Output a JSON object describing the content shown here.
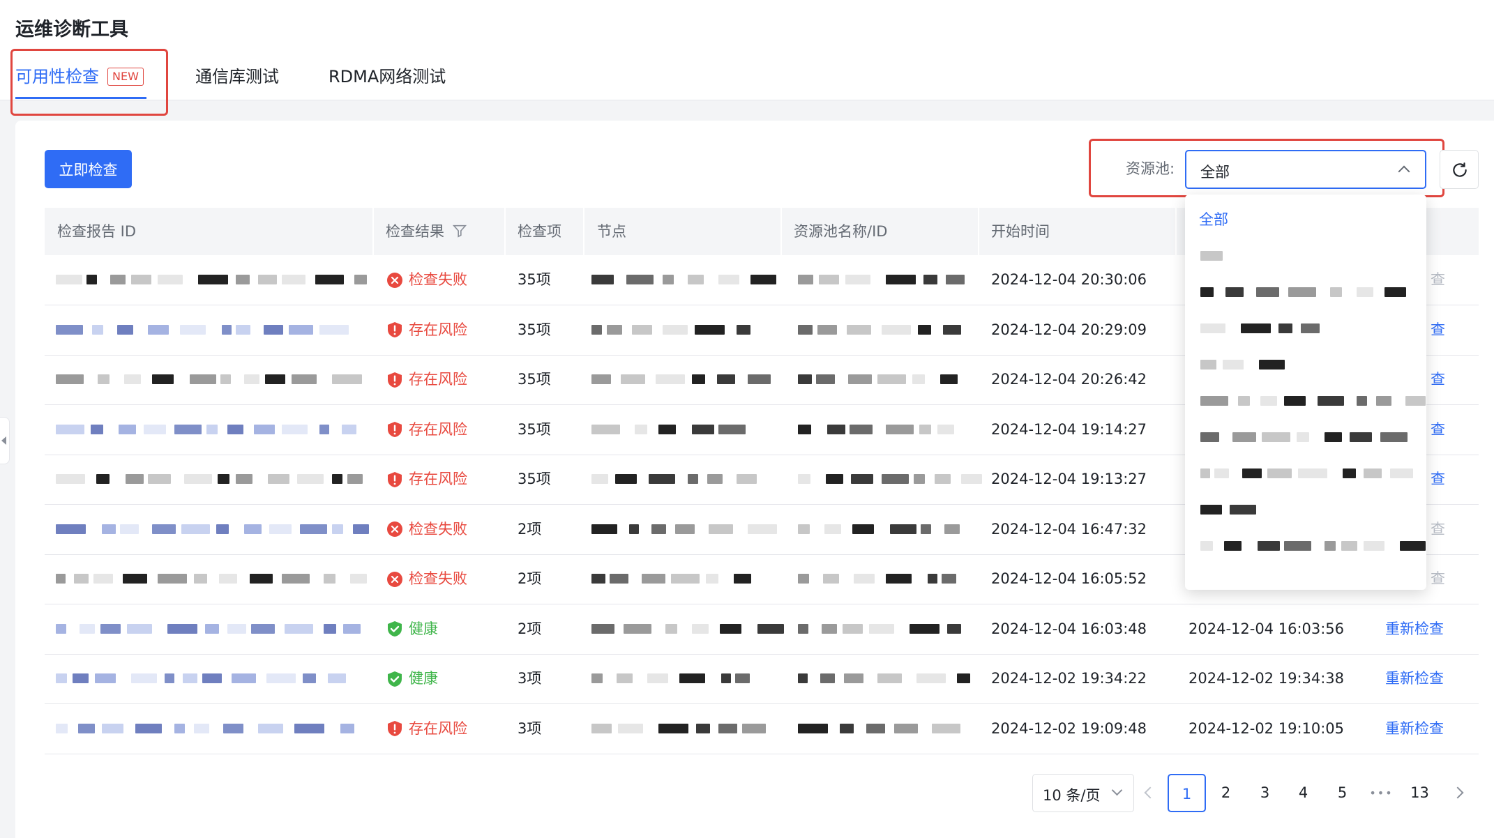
{
  "app_title": "运维诊断工具",
  "tabs": [
    {
      "label": "可用性检查",
      "badge": "NEW"
    },
    {
      "label": "通信库测试"
    },
    {
      "label": "RDMA网络测试"
    }
  ],
  "toolbar": {
    "check_now": "立即检查",
    "pool_label": "资源池:",
    "pool_value": "全部"
  },
  "table": {
    "headers": [
      "检查报告 ID",
      "检查结果",
      "检查项",
      "节点",
      "资源池名称/ID",
      "开始时间"
    ],
    "rows": [
      {
        "result": "检查失败",
        "status": "fail",
        "items": "35项",
        "start": "2024-12-04 20:30:06",
        "end": "",
        "action": "查"
      },
      {
        "result": "存在风险",
        "status": "risk",
        "items": "35项",
        "start": "2024-12-04 20:29:09",
        "end": "",
        "action": "查"
      },
      {
        "result": "存在风险",
        "status": "risk",
        "items": "35项",
        "start": "2024-12-04 20:26:42",
        "end": "",
        "action": "查"
      },
      {
        "result": "存在风险",
        "status": "risk",
        "items": "35项",
        "start": "2024-12-04 19:14:27",
        "end": "",
        "action": "查"
      },
      {
        "result": "存在风险",
        "status": "risk",
        "items": "35项",
        "start": "2024-12-04 19:13:27",
        "end": "",
        "action": "查"
      },
      {
        "result": "检查失败",
        "status": "fail",
        "items": "2项",
        "start": "2024-12-04 16:47:32",
        "end": "",
        "action": "查"
      },
      {
        "result": "检查失败",
        "status": "fail",
        "items": "2项",
        "start": "2024-12-04 16:05:52",
        "end": "",
        "action": "查"
      },
      {
        "result": "健康",
        "status": "ok",
        "items": "2项",
        "start": "2024-12-04 16:03:48",
        "end": "2024-12-04 16:03:56",
        "action": "重新检查"
      },
      {
        "result": "健康",
        "status": "ok",
        "items": "3项",
        "start": "2024-12-02 19:34:22",
        "end": "2024-12-02 19:34:38",
        "action": "重新检查"
      },
      {
        "result": "存在风险",
        "status": "risk",
        "items": "3项",
        "start": "2024-12-02 19:09:48",
        "end": "2024-12-02 19:10:05",
        "action": "重新检查"
      }
    ]
  },
  "dropdown": {
    "selected": "全部"
  },
  "pagination": {
    "page_size": "10 条/页",
    "pages": [
      "1",
      "2",
      "3",
      "4",
      "5"
    ],
    "ellipsis": "•••",
    "last": "13",
    "current": "1"
  },
  "colors": {
    "primary": "#2f6cf5",
    "danger": "#e8493f",
    "success": "#3fb54a",
    "highlight": "#e0463f"
  },
  "icons": {
    "fail": "x-circle-icon",
    "risk": "shield-alert-icon",
    "ok": "shield-check-icon",
    "filter": "filter-icon",
    "refresh": "refresh-icon"
  }
}
